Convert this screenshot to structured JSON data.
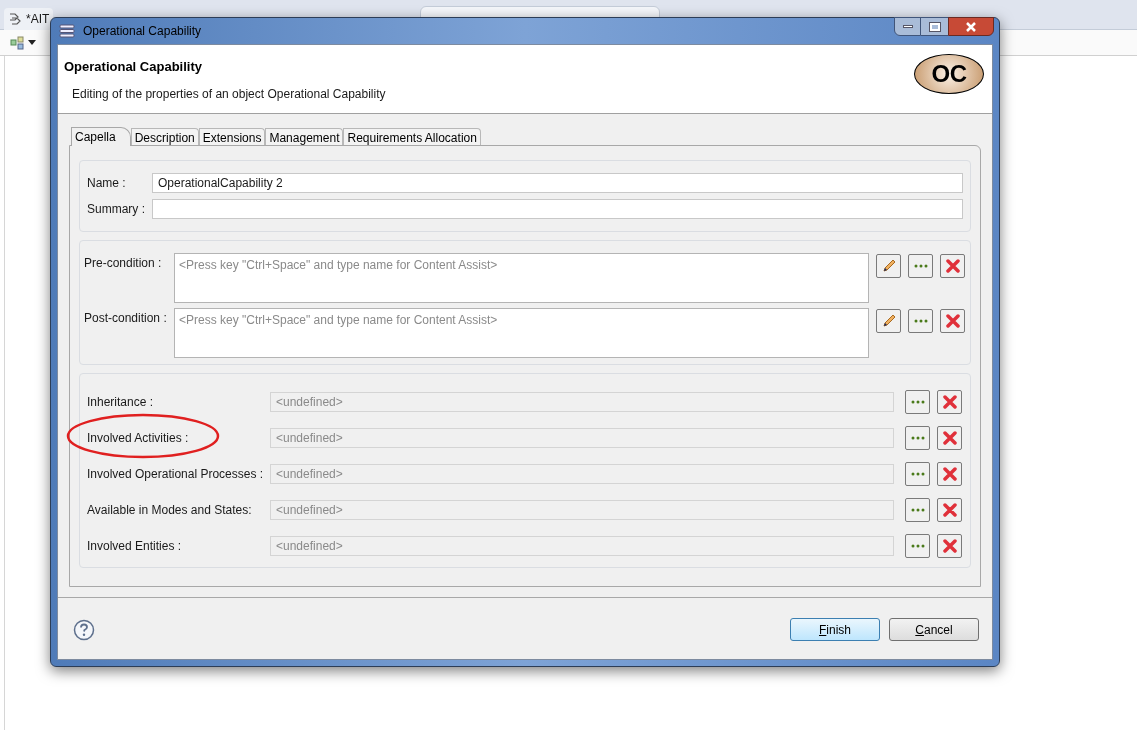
{
  "background_editor": {
    "tab_label": "*AIT"
  },
  "dialog": {
    "title": "Operational Capability",
    "header": {
      "title": "Operational Capability",
      "description": "Editing of the properties of an object Operational Capability",
      "badge": "OC"
    },
    "tabs": [
      {
        "label": "Capella",
        "selected": true
      },
      {
        "label": "Description",
        "selected": false
      },
      {
        "label": "Extensions",
        "selected": false
      },
      {
        "label": "Management",
        "selected": false
      },
      {
        "label": "Requirements Allocation",
        "selected": false
      }
    ],
    "name_field": {
      "label": "Name :",
      "value": "OperationalCapability 2"
    },
    "summary_field": {
      "label": "Summary :"
    },
    "conditions": [
      {
        "label": "Pre-condition :",
        "placeholder": "<Press key \"Ctrl+Space\" and type name for Content Assist>"
      },
      {
        "label": "Post-condition :",
        "placeholder": "<Press key \"Ctrl+Space\" and type name for Content Assist>"
      }
    ],
    "references": [
      {
        "label": "Inheritance :",
        "value": "<undefined>",
        "circled": false
      },
      {
        "label": "Involved Activities :",
        "value": "<undefined>",
        "circled": true
      },
      {
        "label": "Involved Operational Processes :",
        "value": "<undefined>",
        "circled": false
      },
      {
        "label": "Available in Modes and States:",
        "value": "<undefined>",
        "circled": false
      },
      {
        "label": "Involved Entities :",
        "value": "<undefined>",
        "circled": false
      }
    ],
    "buttons": [
      {
        "label": "Finish",
        "default": true
      },
      {
        "label": "Cancel",
        "default": false
      }
    ]
  }
}
